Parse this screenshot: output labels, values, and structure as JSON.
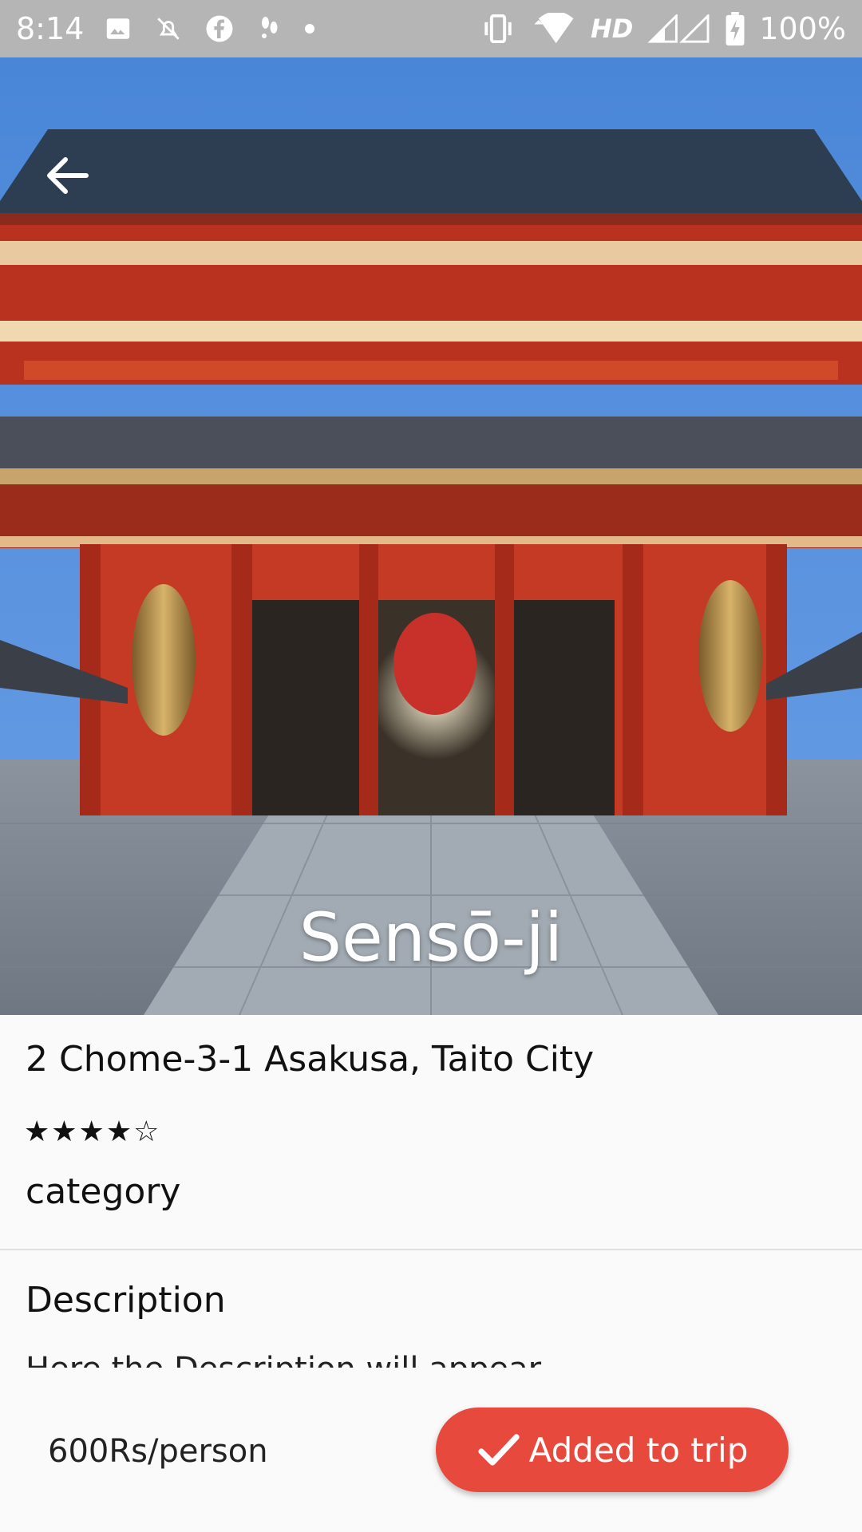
{
  "status_bar": {
    "time": "8:14",
    "network": "HD",
    "battery": "100%",
    "icons": [
      "image-icon",
      "alarm-off-icon",
      "facebook-icon",
      "footsteps-icon",
      "dot-icon",
      "vibrate-icon",
      "wifi-icon",
      "signal-icon",
      "battery-icon"
    ]
  },
  "place": {
    "name": "Sensō-ji",
    "address": "2 Chome-3-1 Asakusa, Taito City",
    "rating": 4,
    "rating_max": 5,
    "rating_text": "★★★★☆",
    "category": "category"
  },
  "description": {
    "heading": "Description",
    "text": "Here the Description will appear"
  },
  "footer": {
    "price": "600Rs/person",
    "trip_button_label": "Added to trip"
  },
  "colors": {
    "accent": "#e8493d",
    "status_bar": "#b5b5b5",
    "background": "#fafafa"
  }
}
